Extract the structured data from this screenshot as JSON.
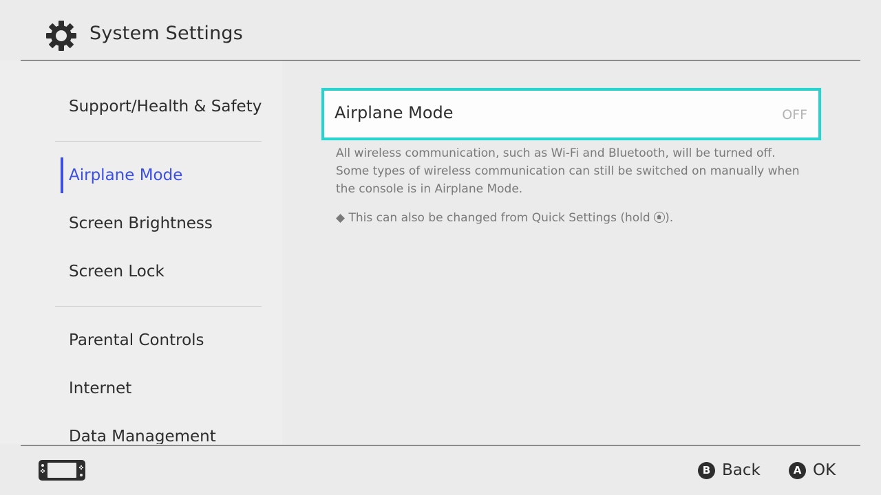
{
  "header": {
    "title": "System Settings",
    "icon": "gear-icon"
  },
  "sidebar": {
    "items": [
      {
        "label": "Support/Health & Safety",
        "selected": false
      },
      {
        "label": "Airplane Mode",
        "selected": true
      },
      {
        "label": "Screen Brightness",
        "selected": false
      },
      {
        "label": "Screen Lock",
        "selected": false
      },
      {
        "label": "Parental Controls",
        "selected": false
      },
      {
        "label": "Internet",
        "selected": false
      },
      {
        "label": "Data Management",
        "selected": false
      }
    ]
  },
  "main": {
    "setting": {
      "label": "Airplane Mode",
      "value": "OFF"
    },
    "description": [
      "All wireless communication, such as Wi-Fi and Bluetooth, will be turned off.",
      "Some types of wireless communication can still be switched on manually when",
      "the console is in Airplane Mode."
    ],
    "note_prefix": "◆ This can also be changed from Quick Settings (hold ",
    "note_suffix": ")."
  },
  "footer": {
    "console_icon": "handheld-console-icon",
    "back": {
      "badge": "B",
      "label": "Back"
    },
    "ok": {
      "badge": "A",
      "label": "OK"
    }
  },
  "colors": {
    "accent_selected": "#3c4fe0",
    "focus_border": "#2bd2ce",
    "background": "#ebebeb"
  }
}
